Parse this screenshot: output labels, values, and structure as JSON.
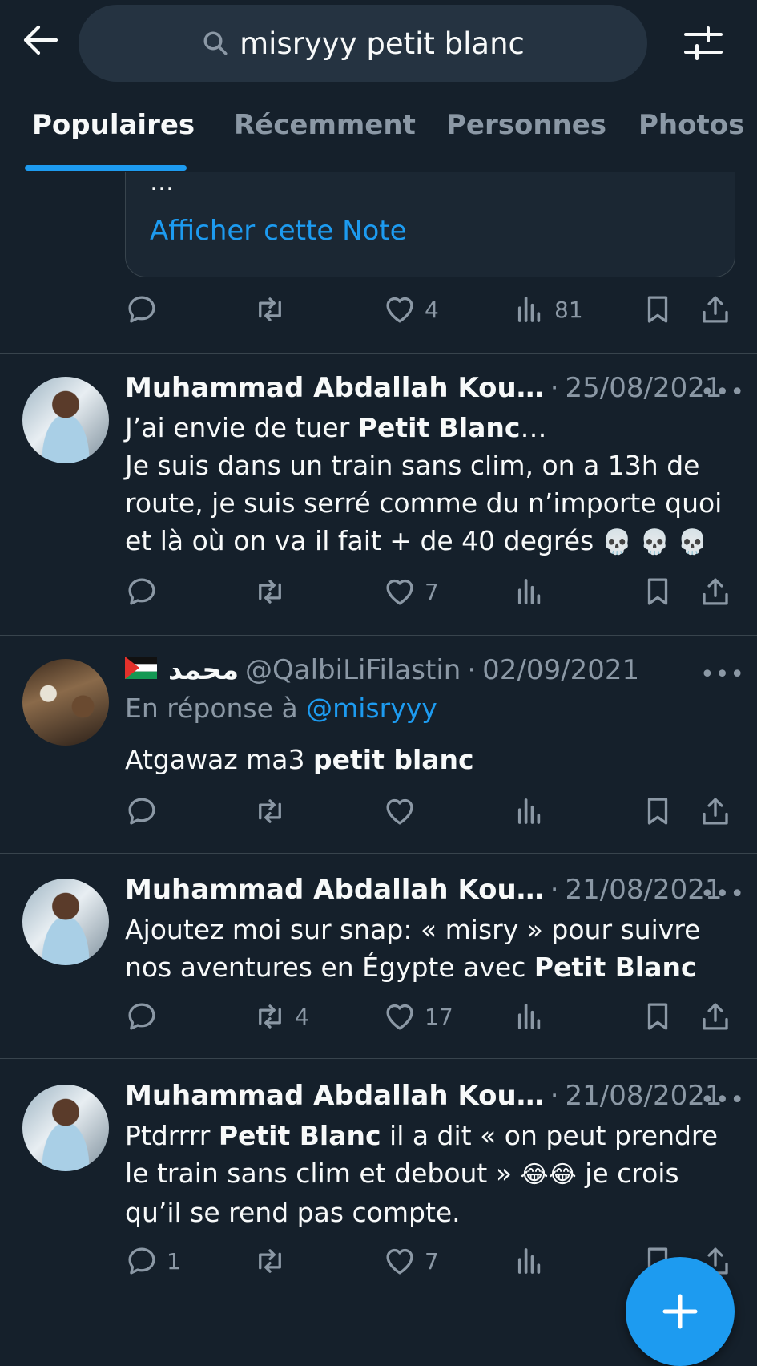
{
  "search": {
    "query": "misryyy petit blanc"
  },
  "tabs": [
    {
      "label": "Populaires"
    },
    {
      "label": "Récemment"
    },
    {
      "label": "Personnes"
    },
    {
      "label": "Photos"
    }
  ],
  "note": {
    "ellipsis": "…",
    "link": "Afficher cette Note"
  },
  "tweets": [
    {
      "actions": {
        "reply": "",
        "retweet": "",
        "like": "4",
        "views": "81"
      }
    },
    {
      "name": "Muhammad Abdallah Kou…",
      "sep": "·",
      "date": "25/08/2021",
      "line1_a": "J’ai envie de tuer ",
      "line1_b": "Petit Blanc",
      "line1_c": "…",
      "line2": "Je suis dans un train sans clim, on a 13h de route, je suis serré comme du n’importe quoi et là où on va il fait + de 40 degrés ",
      "emojis": "💀 💀 💀",
      "actions": {
        "reply": "",
        "retweet": "",
        "like": "7",
        "views": ""
      }
    },
    {
      "name": "محمد",
      "handle": "@QalbiLiFilastin",
      "sep": "·",
      "date": "02/09/2021",
      "reply_to_label": "En réponse à ",
      "reply_to_handle": "@misryyy",
      "text_a": "Atgawaz ma3 ",
      "text_b": "petit blanc",
      "actions": {
        "reply": "",
        "retweet": "",
        "like": "",
        "views": ""
      }
    },
    {
      "name": "Muhammad Abdallah Kou…",
      "sep": "·",
      "date": "21/08/2021",
      "text_a": "Ajoutez moi sur snap: « misry »  pour suivre nos aventures en Égypte avec ",
      "text_b": "Petit Blanc",
      "actions": {
        "reply": "",
        "retweet": "4",
        "like": "17",
        "views": ""
      }
    },
    {
      "name": "Muhammad Abdallah Kou…",
      "sep": "·",
      "date": "21/08/2021",
      "text_a": "Ptdrrrr ",
      "text_b": "Petit Blanc",
      "text_c": " il a dit « on peut prendre le train sans clim et debout » ",
      "emojis": "😂😂",
      "text_d": " je crois qu’il se rend pas compte.",
      "actions": {
        "reply": "1",
        "retweet": "",
        "like": "7",
        "views": ""
      }
    }
  ],
  "colors": {
    "background": "#15202b",
    "accent": "#1d9bf0",
    "muted": "#8b98a5",
    "divider": "#38444d"
  },
  "icons": [
    "back-arrow-icon",
    "search-icon",
    "filter-sliders-icon",
    "reply-icon",
    "retweet-icon",
    "heart-icon",
    "views-icon",
    "bookmark-icon",
    "share-icon",
    "plus-icon"
  ]
}
